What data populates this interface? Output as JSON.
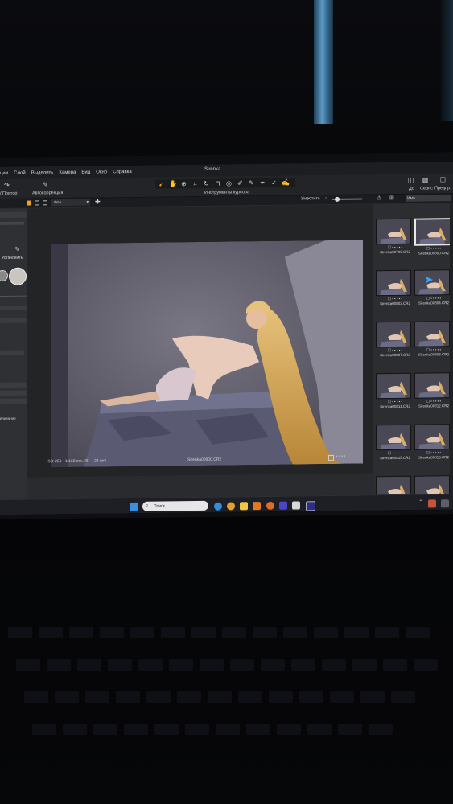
{
  "window": {
    "title": "Sirenka"
  },
  "menu": [
    "ции",
    "Слой",
    "Выделить",
    "Камера",
    "Вид",
    "Окно",
    "Справка"
  ],
  "toolbar": {
    "left_label": "/ Повтор",
    "auto_label": "Автокоррекция",
    "cursor_tools_label": "Инструменты курсора",
    "right_labels": [
      "До",
      "Сеанс",
      "Предпр."
    ]
  },
  "viewer": {
    "layer_select": "Фон",
    "zoom_label": "Уместить",
    "name_field": "Имя",
    "install_label": "Установить",
    "photo_meta": {
      "iso": "ISO 250",
      "shutter": "1/160 сек.",
      "aperture": "f/8",
      "focal": "28 mm"
    },
    "filename": "Sirenka00800.CR2"
  },
  "browser": {
    "items": [
      {
        "name": "Sirenka00799.CR2",
        "selected": false
      },
      {
        "name": "Sirenka00800.CR2",
        "selected": true
      },
      {
        "name": "Sirenka00803.CR2",
        "selected": false
      },
      {
        "name": "Sirenka00804.CR2",
        "selected": false
      },
      {
        "name": "Sirenka00807.CR2",
        "selected": false
      },
      {
        "name": "Sirenka00808.CR2",
        "selected": false
      },
      {
        "name": "Sirenka00811.CR2",
        "selected": false
      },
      {
        "name": "Sirenka00812.CR2",
        "selected": false
      },
      {
        "name": "Sirenka00815.CR2",
        "selected": false
      },
      {
        "name": "Sirenka00816.CR2",
        "selected": false
      },
      {
        "name": "",
        "selected": false
      },
      {
        "name": "",
        "selected": false
      }
    ]
  },
  "left_panel": {
    "text": "вливание"
  },
  "taskbar": {
    "search_placeholder": "Поиск"
  },
  "colors": {
    "accent": "#f0a020",
    "glow": "#5d9cc4"
  }
}
